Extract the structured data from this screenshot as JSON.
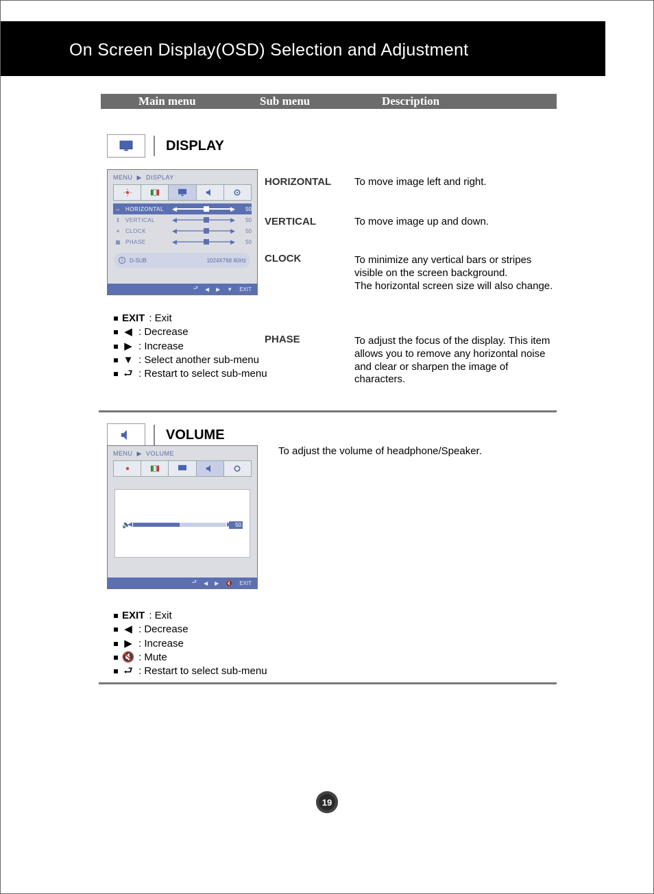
{
  "page_title": "On Screen Display(OSD) Selection and Adjustment",
  "legend": {
    "main": "Main menu",
    "sub": "Sub menu",
    "desc": "Description"
  },
  "display": {
    "title": "DISPLAY",
    "breadcrumb": {
      "root": "MENU",
      "leaf": "DISPLAY"
    },
    "rows": [
      {
        "label": "HORIZONTAL",
        "value": "50",
        "selected": true
      },
      {
        "label": "VERTICAL",
        "value": "50",
        "selected": false
      },
      {
        "label": "CLOCK",
        "value": "50",
        "selected": false
      },
      {
        "label": "PHASE",
        "value": "50",
        "selected": false
      }
    ],
    "info": {
      "source": "D-SUB",
      "mode": "1024X768  60Hz"
    },
    "footer_exit": "EXIT",
    "sub": {
      "horizontal": "HORIZONTAL",
      "vertical": "VERTICAL",
      "clock": "CLOCK",
      "phase": "PHASE"
    },
    "desc": {
      "horizontal": "To move image left and right.",
      "vertical": "To move image up and down.",
      "clock": "To minimize any vertical bars or stripes visible on the screen background.\nThe horizontal screen size will also change.",
      "phase": "To adjust the focus of the display. This item allows you to remove any horizontal noise and clear or sharpen the image of characters."
    },
    "keys": {
      "exit_label": "EXIT",
      "exit_desc": ": Exit",
      "left": ": Decrease",
      "right": ": Increase",
      "down": ": Select another sub-menu",
      "return": ": Restart to select sub-menu"
    }
  },
  "volume": {
    "title": "VOLUME",
    "breadcrumb": {
      "root": "MENU",
      "leaf": "VOLUME"
    },
    "value": "50",
    "footer_exit": "EXIT",
    "desc": "To adjust the volume of headphone/Speaker.",
    "keys": {
      "exit_label": "EXIT",
      "exit_desc": ": Exit",
      "left": ": Decrease",
      "right": ": Increase",
      "mute": ": Mute",
      "return": ": Restart to select sub-menu"
    }
  },
  "page_number": "19"
}
